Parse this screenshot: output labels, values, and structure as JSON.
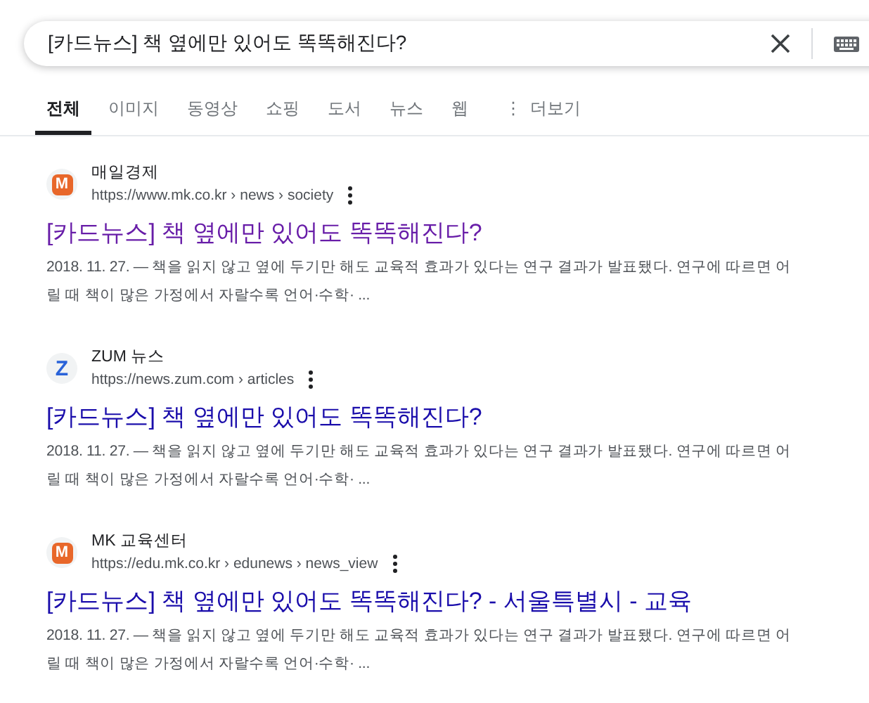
{
  "search": {
    "value": "[카드뉴스] 책 옆에만 있어도 똑똑해진다?"
  },
  "tabs": [
    {
      "label": "전체",
      "selected": true
    },
    {
      "label": "이미지",
      "selected": false
    },
    {
      "label": "동영상",
      "selected": false
    },
    {
      "label": "쇼핑",
      "selected": false
    },
    {
      "label": "도서",
      "selected": false
    },
    {
      "label": "뉴스",
      "selected": false
    },
    {
      "label": "웹",
      "selected": false
    }
  ],
  "more": {
    "icon": "⋮",
    "label": "더보기"
  },
  "results": [
    {
      "logo": "M",
      "kind": "orange",
      "site": "매일경제",
      "url": "https://www.mk.co.kr › news › society",
      "title": "[카드뉴스] 책 옆에만 있어도 똑똑해진다?",
      "visited": true,
      "snippet_lines": [
        "2018. 11. 27. — 책을 읽지 않고 옆에 두기만 해도 교육적 효과가 있다는 연구 결과가 발표됐다. 연구에 따르면 어",
        "릴 때 책이 많은 가정에서 자랄수록 언어·수학· ..."
      ]
    },
    {
      "logo": "Z",
      "kind": "blue",
      "site": "ZUM 뉴스",
      "url": "https://news.zum.com › articles",
      "title": "[카드뉴스] 책 옆에만 있어도 똑똑해진다?",
      "visited": false,
      "snippet_lines": [
        "2018. 11. 27. — 책을 읽지 않고 옆에 두기만 해도 교육적 효과가 있다는 연구 결과가 발표됐다. 연구에 따르면 어",
        "릴 때 책이 많은 가정에서 자랄수록 언어·수학· ..."
      ]
    },
    {
      "logo": "M",
      "kind": "orange",
      "site": "MK 교육센터",
      "url": "https://edu.mk.co.kr › edunews › news_view",
      "title": "[카드뉴스] 책 옆에만 있어도 똑똑해진다? - 서울특별시 - 교육",
      "visited": false,
      "snippet_lines": [
        "2018. 11. 27. — 책을 읽지 않고 옆에 두기만 해도 교육적 효과가 있다는 연구 결과가 발표됐다. 연구에 따르면 어",
        "릴 때 책이 많은 가정에서 자랄수록 언어·수학· ..."
      ]
    }
  ]
}
